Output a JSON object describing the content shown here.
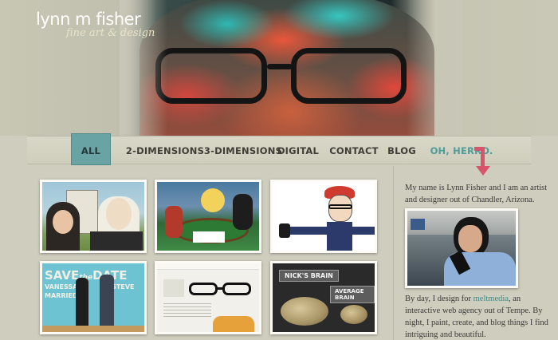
{
  "logo": {
    "name": "lynn m fisher",
    "tagline": "fine art & design"
  },
  "nav": {
    "items": [
      {
        "label": "ALL",
        "active": true
      },
      {
        "label": "2-DIMENSIONS"
      },
      {
        "label": "3-DIMENSIONS"
      },
      {
        "label": "DIGITAL"
      },
      {
        "label": "CONTACT"
      },
      {
        "label": "BLOG"
      },
      {
        "label": "OH, HERRO."
      }
    ]
  },
  "thumbs": {
    "t5_text_save": "SAVE",
    "t5_text_the": "the",
    "t5_text_date": "DATE",
    "t5_text_vanessa": "VANESSA",
    "t5_text_steve": "STEVE",
    "t5_text_married": "MARRIED",
    "t6_text_nicks_brain": "NICK'S BRAIN",
    "t6_text_average_brain": "AVERAGE BRAIN"
  },
  "sidebar": {
    "bio_intro": "My name is Lynn Fisher and I am an artist and designer out of Chandler, Arizona.",
    "bio_day_prefix": "By day, I design for ",
    "bio_link": "meltmedia",
    "bio_day_suffix": ", an interactive web agency out of Tempe. By night, I paint, create, and blog things I find intriguing and beautiful."
  },
  "colors": {
    "background": "#cfcdbd",
    "accent": "#6aa3a3",
    "link": "#3d8d8a",
    "arrow": "#d8546b"
  }
}
